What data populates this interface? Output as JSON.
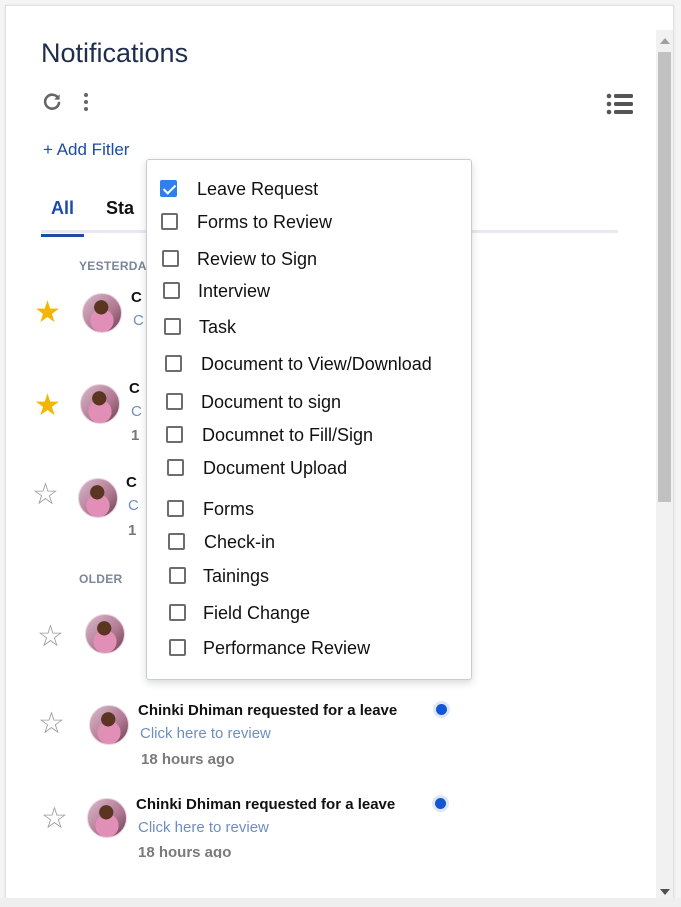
{
  "header": {
    "title": "Notifications",
    "add_filter": "+ Add Fitler"
  },
  "tabs": [
    {
      "label": "All"
    },
    {
      "label": "Sta"
    }
  ],
  "sections": {
    "yesterday": "YESTERDA",
    "older": "OLDER"
  },
  "partial_text": {
    "row1_title": "C",
    "row1_link": "C",
    "row2_title": "C",
    "row2_link": "C",
    "row2_time": "1",
    "row3_title": "C",
    "row3_link": "C",
    "row3_time": "1"
  },
  "notifications": [
    {
      "title": "Chinki Dhiman requested for a leave",
      "link": "Click here to review",
      "time": "18 hours ago",
      "starred": false,
      "unread": true
    },
    {
      "title": "Chinki Dhiman requested for a leave",
      "link": "Click here to review",
      "time": "18 hours ago",
      "starred": false,
      "unread": true
    }
  ],
  "filter_dropdown": {
    "options": [
      {
        "label": "Leave Request",
        "checked": true
      },
      {
        "label": "Forms to Review",
        "checked": false
      },
      {
        "label": "Review to Sign",
        "checked": false
      },
      {
        "label": "Interview",
        "checked": false
      },
      {
        "label": "Task",
        "checked": false
      },
      {
        "label": "Document to View/Download",
        "checked": false
      },
      {
        "label": "Document to sign",
        "checked": false
      },
      {
        "label": "Documnet to Fill/Sign",
        "checked": false
      },
      {
        "label": "Document Upload",
        "checked": false
      },
      {
        "label": "Forms",
        "checked": false
      },
      {
        "label": "Check-in",
        "checked": false
      },
      {
        "label": "Tainings",
        "checked": false
      },
      {
        "label": "Field Change",
        "checked": false
      },
      {
        "label": "Performance Review",
        "checked": false
      }
    ]
  },
  "icons": {
    "refresh": "refresh-icon",
    "more": "more-vertical-icon",
    "list": "list-view-icon",
    "star_filled": "star-filled-icon",
    "star_empty": "star-outline-icon"
  },
  "colors": {
    "accent": "#1d4ba6",
    "title": "#1f2e4d",
    "star": "#f2b705",
    "unread_dot": "#1356d1",
    "checkbox_checked": "#2f80ed",
    "link": "#6e8ec0"
  }
}
